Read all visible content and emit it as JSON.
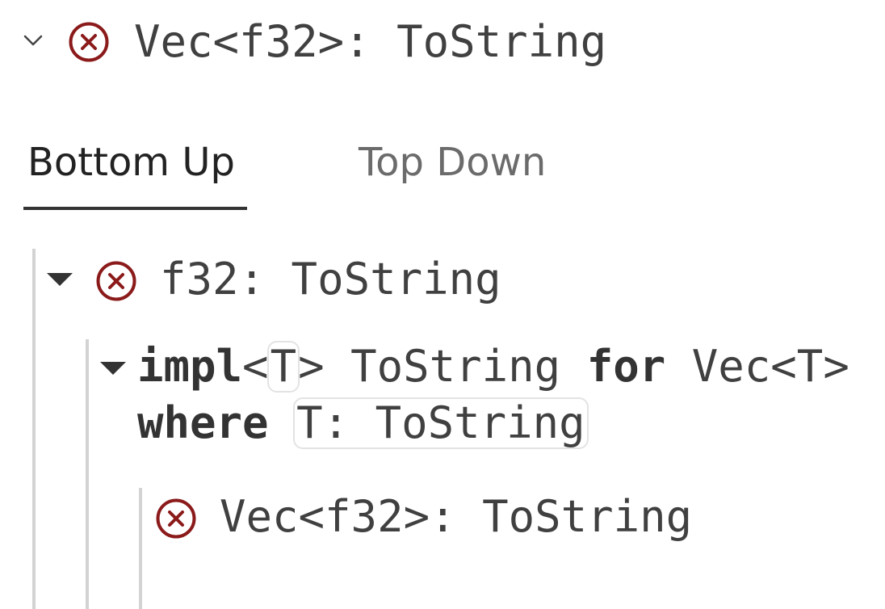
{
  "header": {
    "title": "Vec<f32>: ToString",
    "chevron_icon": "chevron-down-icon",
    "status_icon": "error-circle-icon",
    "error_color": "#8b1a1a"
  },
  "tabs": [
    {
      "label": "Bottom Up",
      "active": true
    },
    {
      "label": "Top Down",
      "active": false
    }
  ],
  "tree": {
    "node1": {
      "label": "f32: ToString",
      "expanded": true,
      "status_icon": "error-circle-icon"
    },
    "node2": {
      "expanded": true,
      "impl_keyword": "impl",
      "lt": "<",
      "type_param": "T",
      "gt_trait": "> ToString ",
      "for_keyword": "for",
      "target": " Vec<T>",
      "where_keyword": "where",
      "bound": "T: ToString"
    },
    "node3": {
      "label": "Vec<f32>: ToString",
      "status_icon": "error-circle-icon"
    }
  }
}
